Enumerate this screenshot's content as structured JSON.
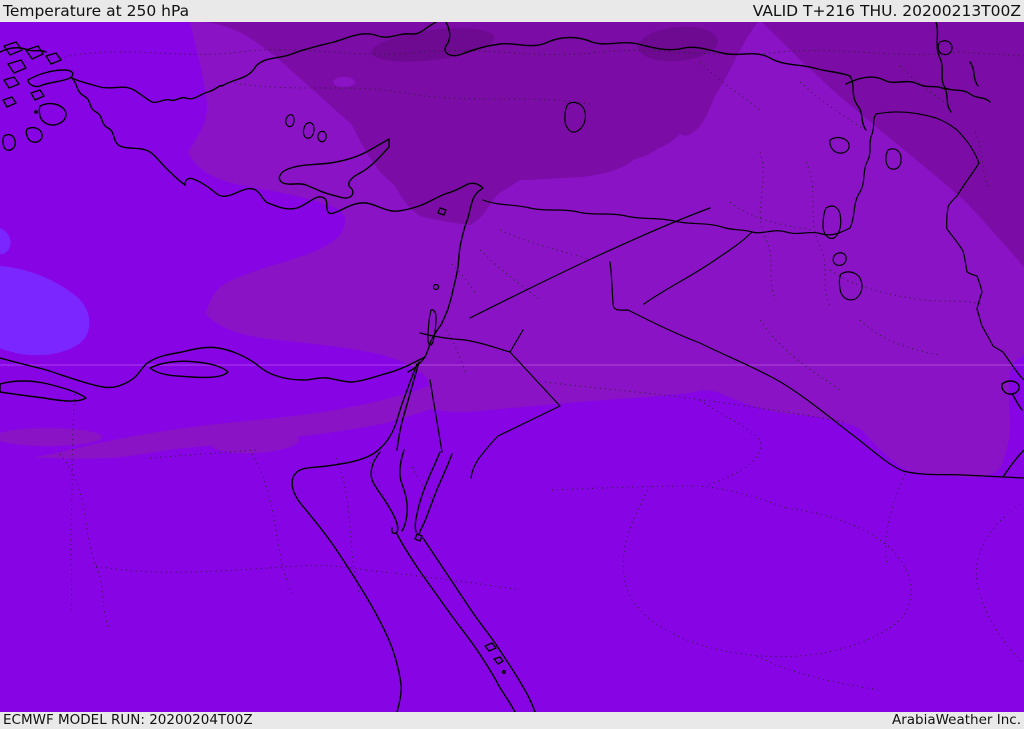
{
  "header": {
    "title": "Temperature at 250 hPa",
    "valid": "VALID T+216 THU. 20200213T00Z"
  },
  "footer": {
    "model_run": "ECMWF MODEL RUN: 20200204T00Z",
    "credit": "ArabiaWeather Inc."
  },
  "map": {
    "description": "ECMWF 250 hPa temperature shaded-contour map of the Middle East",
    "colors": {
      "band_south_bright": "#8704e4",
      "band_mid_muted": "#8a13c6",
      "band_north_dark": "#7b0ca6",
      "band_coldest": "#6e0a92",
      "pocket_blue_violet": "#7c26ff",
      "geo_line": "#000000",
      "bar_background": "#e9e9e9",
      "bar_text": "#111111"
    }
  }
}
